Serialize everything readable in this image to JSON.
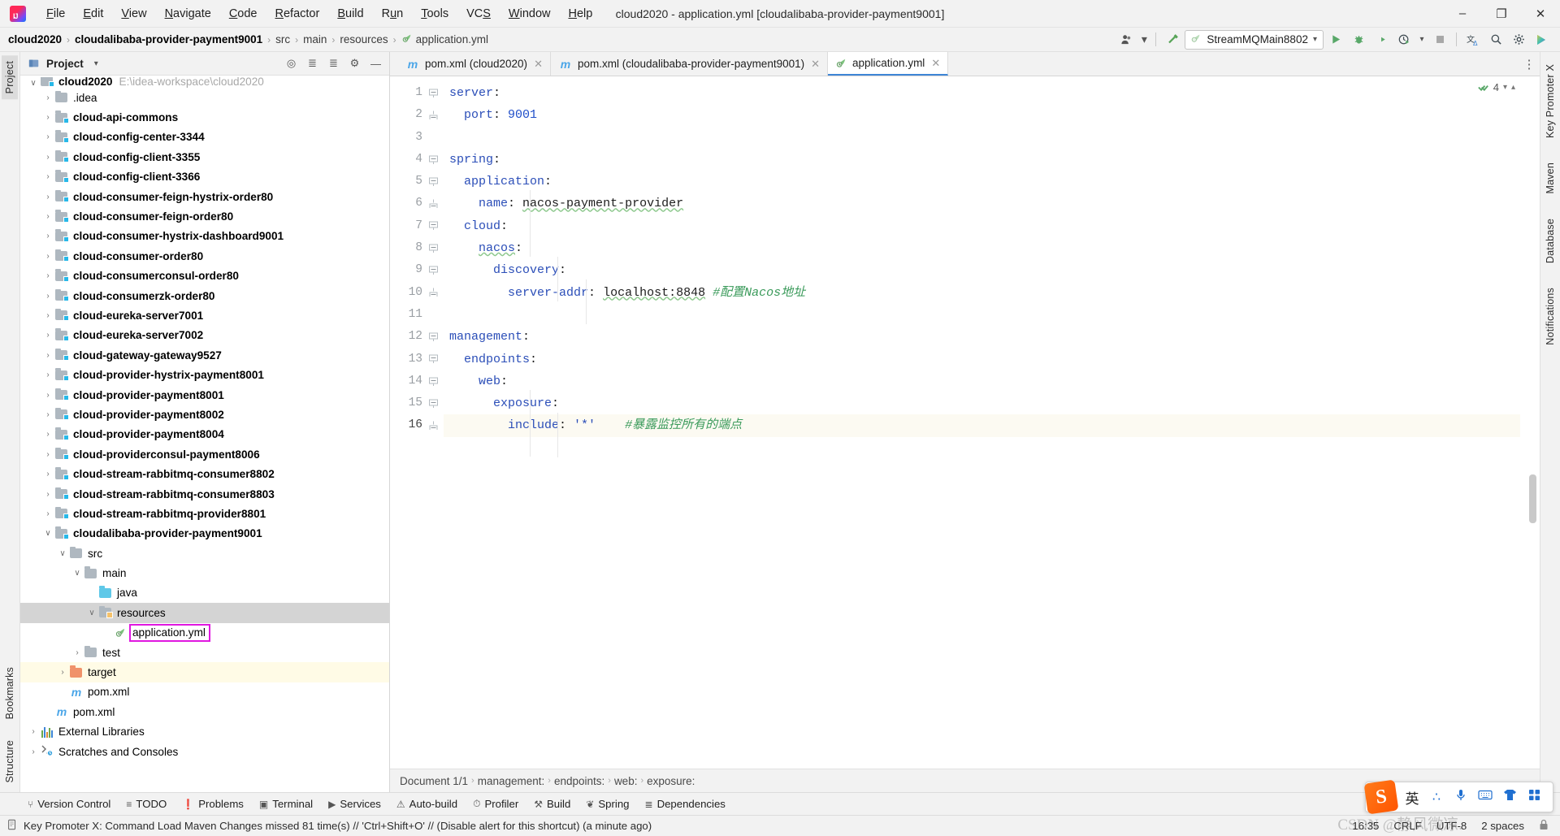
{
  "window": {
    "title": "cloud2020 - application.yml [cloudalibaba-provider-payment9001]",
    "minimize": "–",
    "maximize": "❐",
    "close": "✕"
  },
  "menu": [
    {
      "label": "File"
    },
    {
      "label": "Edit"
    },
    {
      "label": "View"
    },
    {
      "label": "Navigate"
    },
    {
      "label": "Code"
    },
    {
      "label": "Refactor"
    },
    {
      "label": "Build"
    },
    {
      "label": "Run"
    },
    {
      "label": "Tools"
    },
    {
      "label": "VCS"
    },
    {
      "label": "Window"
    },
    {
      "label": "Help"
    }
  ],
  "navbar": {
    "crumbs": [
      {
        "label": "cloud2020",
        "bold": true
      },
      {
        "label": "cloudalibaba-provider-payment9001",
        "bold": true
      },
      {
        "label": "src",
        "bold": false
      },
      {
        "label": "main",
        "bold": false
      },
      {
        "label": "resources",
        "bold": false
      },
      {
        "label": "application.yml",
        "bold": false,
        "icon": "yml-icon"
      }
    ],
    "separator": "›",
    "run_config": "StreamMQMain8802",
    "icons": [
      {
        "name": "account-icon",
        "glyph": "👤"
      },
      {
        "name": "chevron-down-icon",
        "glyph": "▾"
      },
      {
        "name": "build-hammer-icon",
        "glyph": "⚒"
      },
      {
        "name": "run-icon",
        "glyph": "▶"
      },
      {
        "name": "debug-icon",
        "glyph": "🐞"
      },
      {
        "name": "run-with-coverage-icon",
        "glyph": "◑"
      },
      {
        "name": "profiler-icon",
        "glyph": "⏱"
      },
      {
        "name": "stop-icon",
        "glyph": "■"
      },
      {
        "name": "translate-icon",
        "glyph": "文"
      },
      {
        "name": "search-everywhere-icon",
        "glyph": "🔍"
      },
      {
        "name": "settings-gear-icon",
        "glyph": "⚙"
      },
      {
        "name": "update-icon",
        "glyph": "▶"
      }
    ]
  },
  "left_strip": {
    "top": [
      {
        "label": "Project",
        "active": true
      }
    ],
    "bottom": [
      {
        "label": "Bookmarks"
      },
      {
        "label": "Structure"
      }
    ]
  },
  "right_strip": {
    "items": [
      {
        "label": "Key Promoter X"
      },
      {
        "label": "Maven"
      },
      {
        "label": "Database"
      },
      {
        "label": "Notifications"
      }
    ]
  },
  "project_panel": {
    "title": "Project",
    "header_icons": [
      {
        "name": "chevron-down-icon",
        "glyph": "▾"
      },
      {
        "name": "select-opened-file-icon",
        "glyph": "◎"
      },
      {
        "name": "collapse-all-icon",
        "glyph": "≡"
      },
      {
        "name": "expand-all-icon",
        "glyph": "⤢"
      },
      {
        "name": "settings-gear-icon",
        "glyph": "⚙"
      },
      {
        "name": "hide-icon",
        "glyph": "—"
      }
    ],
    "tree": [
      {
        "label": "cloud2020",
        "path": "E:\\idea-workspace\\cloud2020",
        "depth": 0,
        "arrow": "v",
        "icon": "module",
        "bold": true,
        "clipped": true
      },
      {
        "label": ".idea",
        "depth": 1,
        "arrow": ">",
        "icon": "folder-grey",
        "bold": false
      },
      {
        "label": "cloud-api-commons",
        "depth": 1,
        "arrow": ">",
        "icon": "module",
        "bold": true
      },
      {
        "label": "cloud-config-center-3344",
        "depth": 1,
        "arrow": ">",
        "icon": "module",
        "bold": true
      },
      {
        "label": "cloud-config-client-3355",
        "depth": 1,
        "arrow": ">",
        "icon": "module",
        "bold": true
      },
      {
        "label": "cloud-config-client-3366",
        "depth": 1,
        "arrow": ">",
        "icon": "module",
        "bold": true
      },
      {
        "label": "cloud-consumer-feign-hystrix-order80",
        "depth": 1,
        "arrow": ">",
        "icon": "module",
        "bold": true
      },
      {
        "label": "cloud-consumer-feign-order80",
        "depth": 1,
        "arrow": ">",
        "icon": "module",
        "bold": true
      },
      {
        "label": "cloud-consumer-hystrix-dashboard9001",
        "depth": 1,
        "arrow": ">",
        "icon": "module",
        "bold": true
      },
      {
        "label": "cloud-consumer-order80",
        "depth": 1,
        "arrow": ">",
        "icon": "module",
        "bold": true
      },
      {
        "label": "cloud-consumerconsul-order80",
        "depth": 1,
        "arrow": ">",
        "icon": "module",
        "bold": true
      },
      {
        "label": "cloud-consumerzk-order80",
        "depth": 1,
        "arrow": ">",
        "icon": "module",
        "bold": true
      },
      {
        "label": "cloud-eureka-server7001",
        "depth": 1,
        "arrow": ">",
        "icon": "module",
        "bold": true
      },
      {
        "label": "cloud-eureka-server7002",
        "depth": 1,
        "arrow": ">",
        "icon": "module",
        "bold": true
      },
      {
        "label": "cloud-gateway-gateway9527",
        "depth": 1,
        "arrow": ">",
        "icon": "module",
        "bold": true
      },
      {
        "label": "cloud-provider-hystrix-payment8001",
        "depth": 1,
        "arrow": ">",
        "icon": "module",
        "bold": true
      },
      {
        "label": "cloud-provider-payment8001",
        "depth": 1,
        "arrow": ">",
        "icon": "module",
        "bold": true
      },
      {
        "label": "cloud-provider-payment8002",
        "depth": 1,
        "arrow": ">",
        "icon": "module",
        "bold": true
      },
      {
        "label": "cloud-provider-payment8004",
        "depth": 1,
        "arrow": ">",
        "icon": "module",
        "bold": true
      },
      {
        "label": "cloud-providerconsul-payment8006",
        "depth": 1,
        "arrow": ">",
        "icon": "module",
        "bold": true
      },
      {
        "label": "cloud-stream-rabbitmq-consumer8802",
        "depth": 1,
        "arrow": ">",
        "icon": "module",
        "bold": true
      },
      {
        "label": "cloud-stream-rabbitmq-consumer8803",
        "depth": 1,
        "arrow": ">",
        "icon": "module",
        "bold": true
      },
      {
        "label": "cloud-stream-rabbitmq-provider8801",
        "depth": 1,
        "arrow": ">",
        "icon": "module",
        "bold": true
      },
      {
        "label": "cloudalibaba-provider-payment9001",
        "depth": 1,
        "arrow": "v",
        "icon": "module",
        "bold": true
      },
      {
        "label": "src",
        "depth": 2,
        "arrow": "v",
        "icon": "folder-grey",
        "bold": false
      },
      {
        "label": "main",
        "depth": 3,
        "arrow": "v",
        "icon": "folder-grey",
        "bold": false
      },
      {
        "label": "java",
        "depth": 4,
        "arrow": "",
        "icon": "folder-cyan",
        "bold": false
      },
      {
        "label": "resources",
        "depth": 4,
        "arrow": "v",
        "icon": "folder-resources",
        "bold": false,
        "selected": true
      },
      {
        "label": "application.yml",
        "depth": 5,
        "arrow": "",
        "icon": "yml",
        "bold": false,
        "boxed": true
      },
      {
        "label": "test",
        "depth": 3,
        "arrow": ">",
        "icon": "folder-grey",
        "bold": false
      },
      {
        "label": "target",
        "depth": 2,
        "arrow": ">",
        "icon": "folder-orange",
        "bold": false,
        "highlight": true
      },
      {
        "label": "pom.xml",
        "depth": 2,
        "arrow": "",
        "icon": "maven",
        "bold": false
      },
      {
        "label": "pom.xml",
        "depth": 1,
        "arrow": "",
        "icon": "maven",
        "bold": false
      },
      {
        "label": "External Libraries",
        "depth": 0,
        "arrow": ">",
        "icon": "libraries",
        "bold": false
      },
      {
        "label": "Scratches and Consoles",
        "depth": 0,
        "arrow": ">",
        "icon": "scratches",
        "bold": false
      }
    ]
  },
  "editor": {
    "tabs": [
      {
        "label": "pom.xml (cloud2020)",
        "icon": "maven-icon",
        "active": false,
        "closable": true
      },
      {
        "label": "pom.xml (cloudalibaba-provider-payment9001)",
        "icon": "maven-icon",
        "active": false,
        "closable": true
      },
      {
        "label": "application.yml",
        "icon": "yml-icon",
        "active": true,
        "closable": true
      }
    ],
    "inspection": {
      "count": "4",
      "check": "✓"
    },
    "lines": [
      {
        "n": 1,
        "fold": "minus-top",
        "indent": 0,
        "tokens": [
          {
            "t": "server",
            "c": "k"
          },
          {
            "t": ":",
            "c": "v"
          }
        ]
      },
      {
        "n": 2,
        "fold": "end",
        "indent": 2,
        "tokens": [
          {
            "t": "port",
            "c": "k"
          },
          {
            "t": ": ",
            "c": "v"
          },
          {
            "t": "9001",
            "c": "num"
          }
        ]
      },
      {
        "n": 3,
        "fold": "",
        "indent": 0,
        "tokens": []
      },
      {
        "n": 4,
        "fold": "minus-top",
        "indent": 0,
        "tokens": [
          {
            "t": "spring",
            "c": "k"
          },
          {
            "t": ":",
            "c": "v"
          }
        ]
      },
      {
        "n": 5,
        "fold": "minus-top",
        "indent": 2,
        "tokens": [
          {
            "t": "application",
            "c": "k"
          },
          {
            "t": ":",
            "c": "v"
          }
        ]
      },
      {
        "n": 6,
        "fold": "end",
        "indent": 4,
        "tokens": [
          {
            "t": "name",
            "c": "k"
          },
          {
            "t": ": ",
            "c": "v"
          },
          {
            "t": "nacos-payment-provider",
            "c": "v wav"
          }
        ]
      },
      {
        "n": 7,
        "fold": "minus-top",
        "indent": 2,
        "tokens": [
          {
            "t": "cloud",
            "c": "k"
          },
          {
            "t": ":",
            "c": "v"
          }
        ]
      },
      {
        "n": 8,
        "fold": "minus-top",
        "indent": 4,
        "tokens": [
          {
            "t": "nacos",
            "c": "k wav"
          },
          {
            "t": ":",
            "c": "v"
          }
        ]
      },
      {
        "n": 9,
        "fold": "minus-top",
        "indent": 6,
        "tokens": [
          {
            "t": "discovery",
            "c": "k"
          },
          {
            "t": ":",
            "c": "v"
          }
        ]
      },
      {
        "n": 10,
        "fold": "end",
        "indent": 8,
        "tokens": [
          {
            "t": "server-addr",
            "c": "k"
          },
          {
            "t": ": ",
            "c": "v"
          },
          {
            "t": "localhost:8848",
            "c": "v wav"
          },
          {
            "t": " ",
            "c": "v"
          },
          {
            "t": "#配置Nacos地址",
            "c": "cm"
          }
        ]
      },
      {
        "n": 11,
        "fold": "",
        "indent": 0,
        "tokens": []
      },
      {
        "n": 12,
        "fold": "minus-top",
        "indent": 0,
        "tokens": [
          {
            "t": "management",
            "c": "k"
          },
          {
            "t": ":",
            "c": "v"
          }
        ]
      },
      {
        "n": 13,
        "fold": "minus-top",
        "indent": 2,
        "tokens": [
          {
            "t": "endpoints",
            "c": "k"
          },
          {
            "t": ":",
            "c": "v"
          }
        ]
      },
      {
        "n": 14,
        "fold": "minus-top",
        "indent": 4,
        "tokens": [
          {
            "t": "web",
            "c": "k"
          },
          {
            "t": ":",
            "c": "v"
          }
        ]
      },
      {
        "n": 15,
        "fold": "minus-top",
        "indent": 6,
        "tokens": [
          {
            "t": "exposure",
            "c": "k"
          },
          {
            "t": ":",
            "c": "v"
          }
        ]
      },
      {
        "n": 16,
        "fold": "end",
        "indent": 8,
        "tokens": [
          {
            "t": "include",
            "c": "k"
          },
          {
            "t": ": ",
            "c": "v"
          },
          {
            "t": "'*'",
            "c": "str"
          },
          {
            "t": "    ",
            "c": "v"
          },
          {
            "t": "#暴露监控所有的端点",
            "c": "cm"
          }
        ],
        "current": true
      }
    ],
    "breadcrumbs": [
      "Document 1/1",
      "management:",
      "endpoints:",
      "web:",
      "exposure:"
    ],
    "breadcrumb_sep": "›"
  },
  "bottom_toolwindows": [
    {
      "label": "Version Control",
      "icon": "branch-icon",
      "glyph": "⑂"
    },
    {
      "label": "TODO",
      "icon": "todo-list-icon",
      "glyph": "≡"
    },
    {
      "label": "Problems",
      "icon": "problems-icon",
      "glyph": "❗"
    },
    {
      "label": "Terminal",
      "icon": "terminal-icon",
      "glyph": "▣"
    },
    {
      "label": "Services",
      "icon": "services-icon",
      "glyph": "▶"
    },
    {
      "label": "Auto-build",
      "icon": "auto-build-icon",
      "glyph": "⚠"
    },
    {
      "label": "Profiler",
      "icon": "profiler-icon",
      "glyph": "⏱"
    },
    {
      "label": "Build",
      "icon": "build-hammer-icon",
      "glyph": "⚒"
    },
    {
      "label": "Spring",
      "icon": "spring-leaf-icon",
      "glyph": "❦"
    },
    {
      "label": "Dependencies",
      "icon": "dependencies-icon",
      "glyph": "≣"
    }
  ],
  "statusbar": {
    "message": "Key Promoter X: Command Load Maven Changes missed 81 time(s) // 'Ctrl+Shift+O' // (Disable alert for this shortcut) (a minute ago)",
    "message_icon": "notification-icon",
    "right": [
      {
        "label": "16:35",
        "name": "time"
      },
      {
        "label": "CRLF",
        "name": "line-separator"
      },
      {
        "label": "UTF-8",
        "name": "encoding"
      },
      {
        "label": "2 spaces",
        "name": "indent"
      },
      {
        "label": "⚑",
        "name": "lock-icon"
      }
    ]
  },
  "ime": {
    "logo": "S",
    "items": [
      {
        "glyph": "英",
        "name": "language-mode"
      },
      {
        "glyph": "∴",
        "name": "punctuation-mode"
      },
      {
        "glyph": "🎤",
        "name": "voice-input-icon"
      },
      {
        "glyph": "⌨",
        "name": "keyboard-icon"
      },
      {
        "glyph": "👕",
        "name": "skin-icon"
      },
      {
        "glyph": "▒",
        "name": "toolbox-icon"
      }
    ]
  },
  "watermark": "CSDN @静风微凉."
}
